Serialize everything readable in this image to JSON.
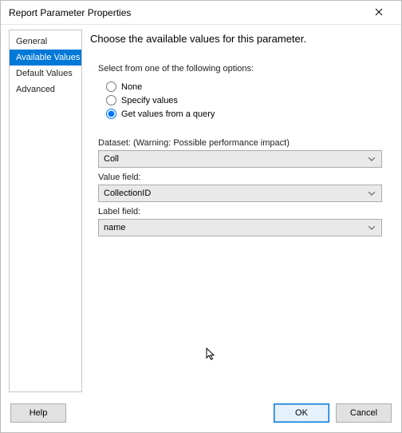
{
  "window": {
    "title": "Report Parameter Properties"
  },
  "sidebar": {
    "items": [
      {
        "label": "General"
      },
      {
        "label": "Available Values"
      },
      {
        "label": "Default Values"
      },
      {
        "label": "Advanced"
      }
    ],
    "selectedIndex": 1
  },
  "main": {
    "headline": "Choose the available values for this parameter.",
    "optionsLabel": "Select from one of the following options:",
    "radios": {
      "none": "None",
      "specify": "Specify values",
      "query": "Get values from a query"
    },
    "selectedRadio": "query",
    "dataset": {
      "label": "Dataset: (Warning: Possible performance impact)",
      "value": "Coll"
    },
    "valueField": {
      "label": "Value field:",
      "value": "CollectionID"
    },
    "labelField": {
      "label": "Label field:",
      "value": "name"
    }
  },
  "footer": {
    "help": "Help",
    "ok": "OK",
    "cancel": "Cancel"
  }
}
